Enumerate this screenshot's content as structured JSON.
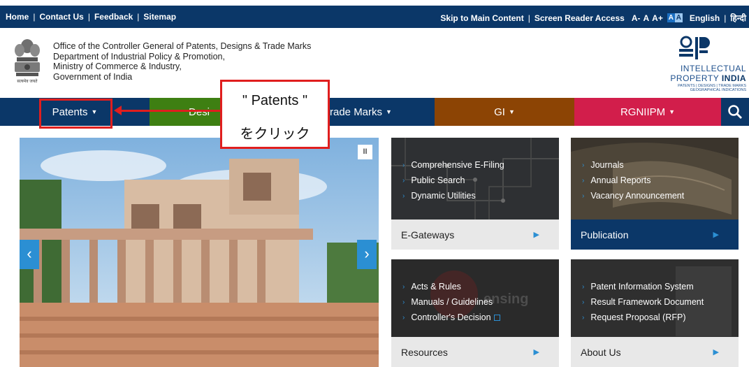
{
  "topbar": {
    "links": [
      "Home",
      "Contact Us",
      "Feedback",
      "Sitemap"
    ],
    "skip": "Skip to Main Content",
    "reader": "Screen Reader Access",
    "font_small": "A-",
    "font_normal": "A",
    "font_large": "A+",
    "contrast_a": "A",
    "contrast_b": "A",
    "lang_en": "English",
    "lang_hi": "हिन्दी"
  },
  "header": {
    "emblem_caption": "सत्यमेव जयते",
    "org_lines": [
      "Office of the Controller General of Patents, Designs & Trade Marks",
      "Department of Industrial Policy & Promotion,",
      "Ministry of Commerce & Industry,",
      "Government of India"
    ],
    "logo_line1": "INTELLECTUAL",
    "logo_line2a": "PROPERTY ",
    "logo_line2b": "INDIA",
    "logo_line3": "PATENTS | DESIGNS | TRADE MARKS",
    "logo_line4": "GEOGRAPHICAL INDICATIONS"
  },
  "nav": {
    "patents": "Patents",
    "designs": "Desi",
    "trademarks": "rade Marks",
    "gi": "GI",
    "rgniipm": "RGNIIPM"
  },
  "callout": {
    "line1": "\" Patents \"",
    "line2": "をクリック"
  },
  "slider": {
    "pause": "II",
    "prev": "‹",
    "next": "›"
  },
  "tiles": {
    "egateways": {
      "items": [
        "Comprehensive E-Filing",
        "Public Search",
        "Dynamic Utilities"
      ],
      "title": "E-Gateways"
    },
    "publication": {
      "items": [
        "Journals",
        "Annual Reports",
        "Vacancy Announcement"
      ],
      "title": "Publication"
    },
    "resources": {
      "items": [
        "Acts & Rules",
        "Manuals / Guidelines",
        "Controller's Decision"
      ],
      "title": "Resources",
      "watermark": "ensing"
    },
    "about": {
      "items": [
        "Patent Information System",
        "Result Framework Document",
        "Request Proposal (RFP)"
      ],
      "title": "About Us"
    }
  },
  "colors": {
    "navy": "#0b3768",
    "green": "#3e7f12",
    "brown": "#8c4404",
    "crimson": "#d21e4b",
    "accent_blue": "#2b8fd3",
    "highlight_red": "#e01e1e"
  }
}
